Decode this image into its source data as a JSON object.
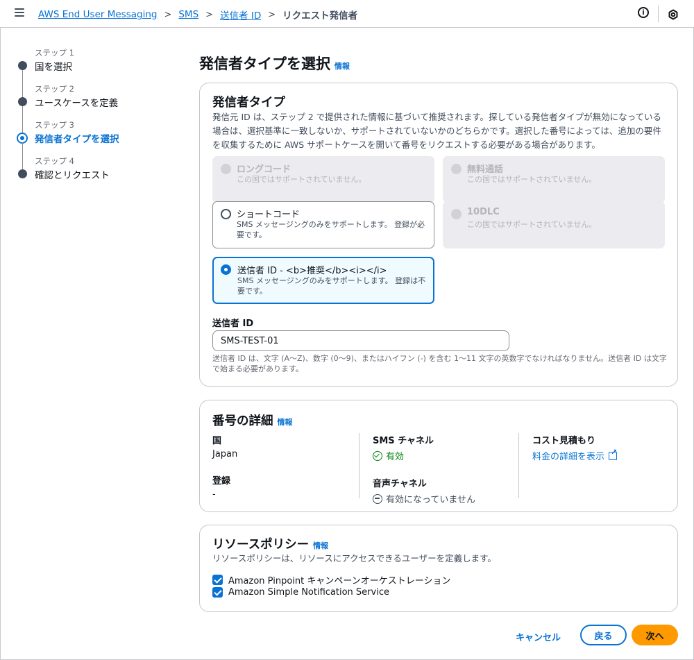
{
  "header": {
    "breadcrumbs": [
      "AWS End User Messaging",
      "SMS",
      "送信者 ID"
    ],
    "current": "リクエスト発信者",
    "separator": ">",
    "info_icon_glyph": "i"
  },
  "steps": [
    {
      "num": "ステップ 1",
      "title": "国を選択"
    },
    {
      "num": "ステップ 2",
      "title": "ユースケースを定義"
    },
    {
      "num": "ステップ 3",
      "title": "発信者タイプを選択"
    },
    {
      "num": "ステップ 4",
      "title": "確認とリクエスト"
    }
  ],
  "page": {
    "title": "発信者タイプを選択",
    "info": "情報"
  },
  "originator": {
    "heading": "発信者タイプ",
    "description": "発信元 ID は、ステップ 2 で提供された情報に基づいて推奨されます。探している発信者タイプが無効になっている場合は、選択基準に一致しないか、サポートされていないかのどちらかです。選択した番号によっては、追加の要件を収集するために AWS サポートケースを開いて番号をリクエストする必要がある場合があります。",
    "options": [
      {
        "label": "ロングコード",
        "sub": "この国ではサポートされていません。"
      },
      {
        "label": "無料通話",
        "sub": "この国ではサポートされていません。"
      },
      {
        "label": "ショートコード",
        "sub": "SMS メッセージングのみをサポートします。 登録が必要です。"
      },
      {
        "label": "10DLC",
        "sub": "この国ではサポートされていません。"
      },
      {
        "label": "送信者 ID - <b>推奨</b><i></i>",
        "sub": "SMS メッセージングのみをサポートします。 登録は不要です。"
      }
    ],
    "sender_id_label": "送信者 ID",
    "sender_id_value": "SMS-TEST-01",
    "sender_id_hint": "送信者 ID は、文字 (A〜Z)、数字 (0〜9)、またはハイフン (-) を含む 1〜11 文字の英数字でなければなりません。送信者 ID は文字で始まる必要があります。"
  },
  "number_details": {
    "heading": "番号の詳細",
    "info": "情報",
    "country_key": "国",
    "country_value": "Japan",
    "registration_key": "登録",
    "registration_value": "-",
    "sms_key": "SMS チャネル",
    "sms_value": "有効",
    "voice_key": "音声チャネル",
    "voice_value": "有効になっていません",
    "cost_key": "コスト見積もり",
    "cost_link": "料金の詳細を表示"
  },
  "resource_policy": {
    "heading": "リソースポリシー",
    "info": "情報",
    "description": "リソースポリシーは、リソースにアクセスできるユーザーを定義します。",
    "checkboxes": [
      "Amazon Pinpoint キャンペーンオーケストレーション",
      "Amazon Simple Notification Service"
    ]
  },
  "footer": {
    "cancel": "キャンセル",
    "back": "戻る",
    "next": "次へ"
  },
  "colors": {
    "link": "#0972d3",
    "primary_button": "#ff9900",
    "success": "#037f0c"
  }
}
